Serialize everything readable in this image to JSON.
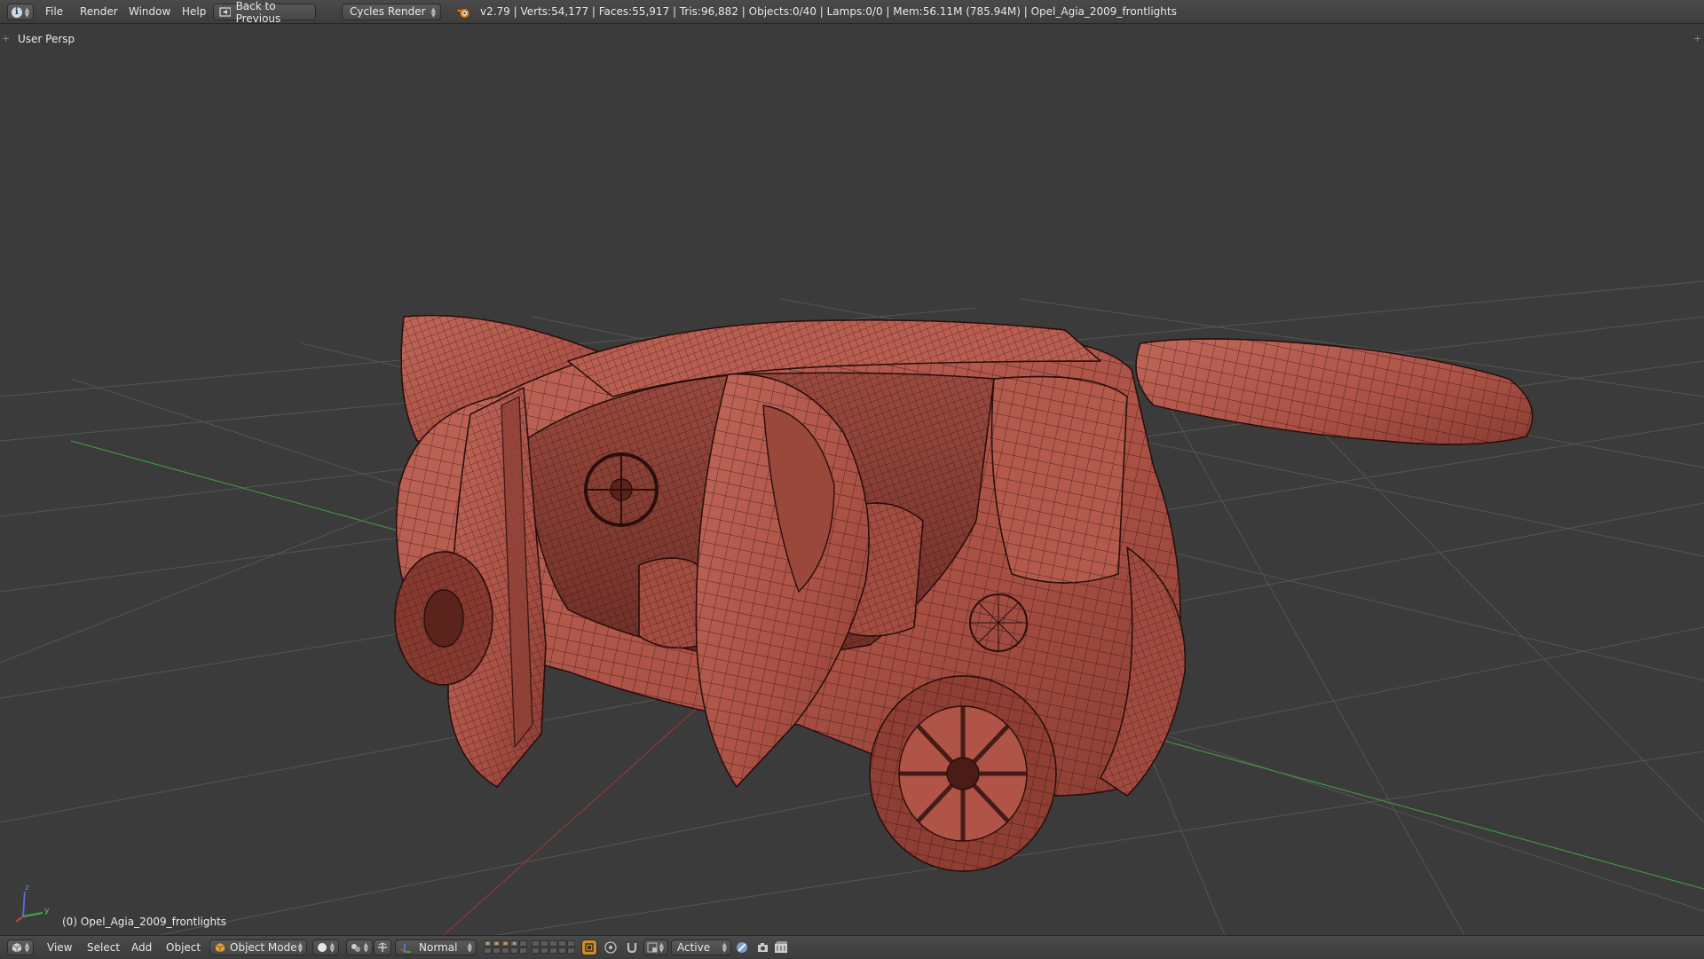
{
  "header": {
    "editor_icon": "info-icon",
    "menus": [
      "File",
      "Render",
      "Window",
      "Help"
    ],
    "back_button": "Back to Previous",
    "render_engine": "Cycles Render",
    "stats": "v2.79 | Verts:54,177 | Faces:55,917 | Tris:96,882 | Objects:0/40 | Lamps:0/0 | Mem:56.11M (785.94M) | Opel_Agia_2009_frontlights"
  },
  "viewport": {
    "view_label": "User Persp",
    "object_label": "(0) Opel_Agia_2009_frontlights",
    "model_color": "#b0564a",
    "wire_color": "#2a0f0c",
    "grid_color": "#555555",
    "x_axis_color": "#8a3a3a",
    "y_axis_color": "#3f8f3f"
  },
  "footer": {
    "editor_icon": "3d-view-icon",
    "menus": [
      "View",
      "Select",
      "Add",
      "Object"
    ],
    "mode": "Object Mode",
    "pivot": "Normal",
    "snap_target": "Active"
  }
}
